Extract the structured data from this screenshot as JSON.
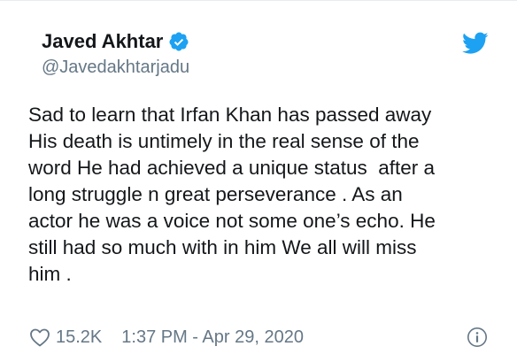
{
  "author": {
    "name": "Javed Akhtar",
    "handle": "@Javedakhtarjadu",
    "verified_icon": "verified-badge-icon",
    "brand_icon": "twitter-bird-icon"
  },
  "tweet": {
    "lines": [
      "Sad to learn that Irfan Khan has passed away",
      "His death is untimely in the real sense of the",
      "word He had achieved a unique status  after a",
      "long struggle n great perseverance . As an",
      "actor he was a voice not some one’s echo. He",
      "still had so much with in him We all will miss",
      "him ."
    ]
  },
  "footer": {
    "like_icon": "heart-outline-icon",
    "likes": "15.2K",
    "timestamp": "1:37 PM - Apr 29, 2020",
    "info_icon": "info-circle-icon"
  },
  "colors": {
    "text": "#14171a",
    "secondary": "#657786",
    "brand_blue": "#1da1f2"
  }
}
